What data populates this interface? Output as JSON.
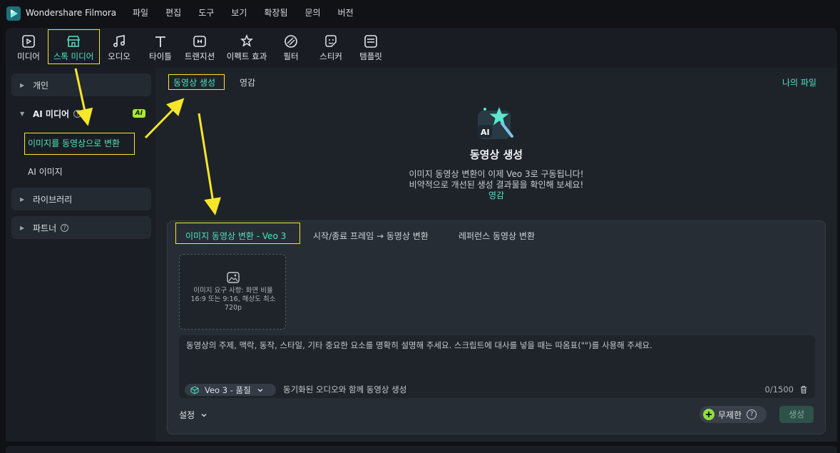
{
  "app": {
    "title": "Wondershare Filmora"
  },
  "menu": [
    "파일",
    "편집",
    "도구",
    "보기",
    "확장됨",
    "문의",
    "버전"
  ],
  "toolbar": {
    "items": [
      {
        "label": "미디어",
        "icon": "media-icon"
      },
      {
        "label": "스톡 미디어",
        "icon": "stock-media-icon",
        "active": true
      },
      {
        "label": "오디오",
        "icon": "music-note-icon"
      },
      {
        "label": "타이틀",
        "icon": "title-text-icon"
      },
      {
        "label": "트랜지션",
        "icon": "transition-icon"
      },
      {
        "label": "이펙트 효과",
        "icon": "effects-icon"
      },
      {
        "label": "필터",
        "icon": "filter-icon"
      },
      {
        "label": "스티커",
        "icon": "sticker-icon"
      },
      {
        "label": "템플릿",
        "icon": "template-icon"
      }
    ]
  },
  "sidebar": {
    "personal": "개인",
    "ai_media": "AI 미디어",
    "ai_badge": "AI",
    "image_to_video": "이미지를 동영상으로 변환",
    "ai_image": "AI 이미지",
    "library": "라이브러리",
    "partner": "파트너"
  },
  "main": {
    "tabs": [
      "동영상 생성",
      "영감"
    ],
    "my_files": "나의 파일",
    "hero": {
      "title": "동영상 생성",
      "line1": "이미지 동영상 변환이 이제 Veo 3로 구동됩니다!",
      "line2": "비약적으로 개선된 생성 결과물을 확인해 보세요!",
      "link": "영감"
    },
    "panel_tabs": [
      "이미지 동영상 변환 - Veo 3",
      "시작/종료 프레임 → 동영상 변환",
      "레퍼런스 동영상 변환"
    ],
    "upload": {
      "requirements": "이미지 요구 사항: 화면 비율 16:9 또는 9:16, 해상도 최소 720p"
    },
    "prompt": {
      "placeholder": "동영상의 주제, 맥락, 동작, 스타일, 기타 중요한 요소를 명확히 설명해 주세요. 스크립트에 대사를 넣을 때는 따옴표(\"\")를 사용해 주세요.",
      "model": "Veo 3 - 품질",
      "audio_note": "동기화된 오디오와 함께 동영상 생성",
      "counter": "0/1500"
    },
    "settings_label": "설정",
    "unlimited_label": "무제한",
    "generate_label": "생성"
  },
  "colors": {
    "accent": "#4fe3c1",
    "highlight": "#f7e62a",
    "ai_badge": "#a8e83a"
  }
}
